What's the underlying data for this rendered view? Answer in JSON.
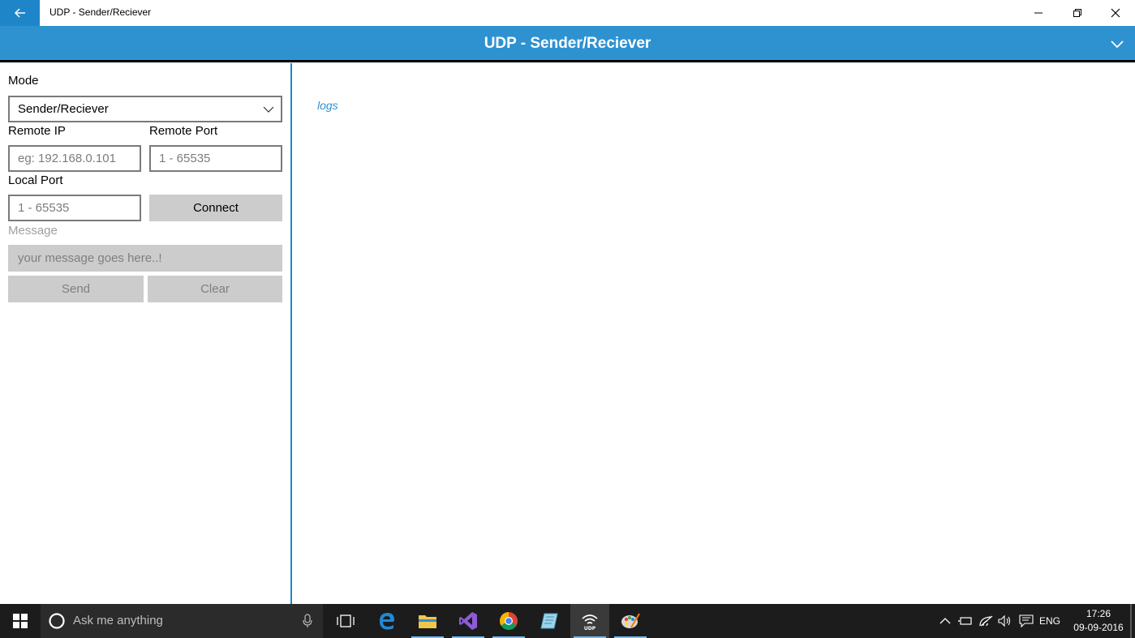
{
  "window": {
    "title": "UDP - Sender/Reciever"
  },
  "header": {
    "title": "UDP - Sender/Reciever"
  },
  "form": {
    "mode_label": "Mode",
    "mode_value": "Sender/Reciever",
    "remote_ip_label": "Remote IP",
    "remote_ip_placeholder": "eg: 192.168.0.101",
    "remote_port_label": "Remote Port",
    "remote_port_placeholder": "1 - 65535",
    "local_port_label": "Local Port",
    "local_port_placeholder": "1 - 65535",
    "connect_label": "Connect",
    "message_label": "Message",
    "message_placeholder": "your message goes here..!",
    "send_label": "Send",
    "clear_label": "Clear"
  },
  "logs": {
    "text": "logs"
  },
  "taskbar": {
    "search_placeholder": "Ask me anything",
    "language": "ENG",
    "time": "17:26",
    "date": "09-09-2016"
  },
  "colors": {
    "accent": "#2e92d1",
    "back_button": "#1e86c8",
    "taskbar": "#1c1c1c"
  }
}
